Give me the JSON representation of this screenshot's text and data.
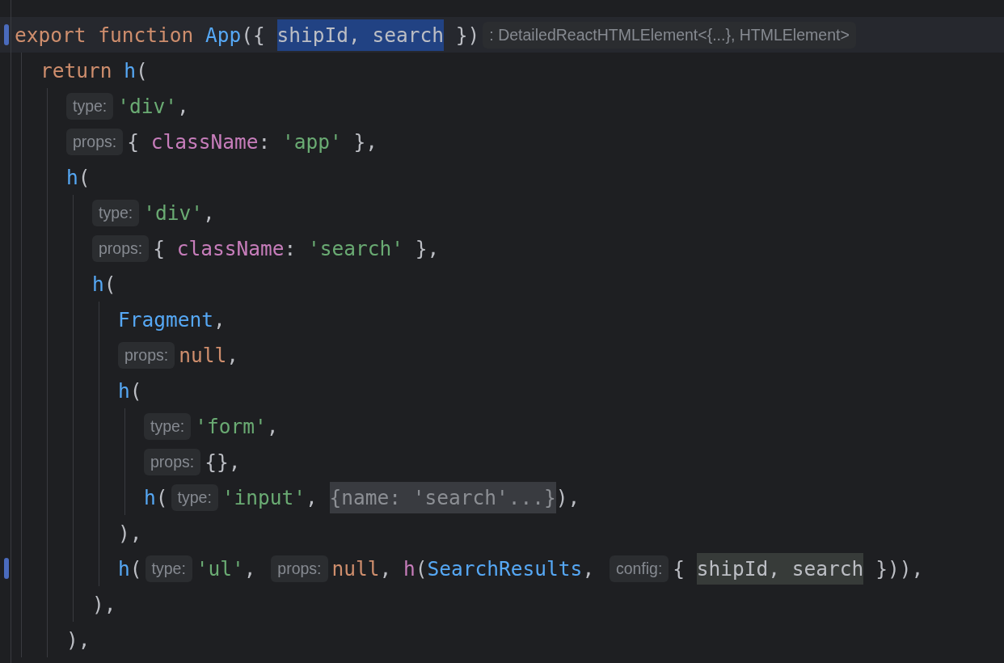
{
  "lines": [
    {
      "modified": true,
      "current": true,
      "tokens": [
        {
          "kind": "keyword",
          "t": "export"
        },
        {
          "kind": "keyword",
          "t": " function"
        },
        {
          "kind": "fn",
          "t": " App"
        },
        {
          "kind": "plain",
          "t": "({ "
        },
        {
          "kind": "selection",
          "t": "shipId, search"
        },
        {
          "kind": "plain",
          "t": " })"
        },
        {
          "kind": "hint",
          "t": ": DetailedReactHTMLElement<{...}, HTMLElement>"
        }
      ],
      "children": [
        {
          "modified": false,
          "current": false,
          "tokens": [
            {
              "kind": "keyword",
              "t": "return"
            },
            {
              "kind": "fn",
              "t": " h"
            },
            {
              "kind": "plain",
              "t": "("
            }
          ],
          "children": [
            {
              "modified": false,
              "current": false,
              "tokens": [
                {
                  "kind": "hint",
                  "t": "type:"
                },
                {
                  "kind": "string",
                  "t": "'div'"
                },
                {
                  "kind": "plain",
                  "t": ","
                }
              ]
            },
            {
              "modified": false,
              "current": false,
              "tokens": [
                {
                  "kind": "hint",
                  "t": "props:"
                },
                {
                  "kind": "plain",
                  "t": "{ "
                },
                {
                  "kind": "prop",
                  "t": "className"
                },
                {
                  "kind": "plain",
                  "t": ": "
                },
                {
                  "kind": "string",
                  "t": "'app'"
                },
                {
                  "kind": "plain",
                  "t": " },"
                }
              ]
            },
            {
              "modified": false,
              "current": false,
              "tokens": [
                {
                  "kind": "fn",
                  "t": "h"
                },
                {
                  "kind": "plain",
                  "t": "("
                }
              ],
              "children": [
                {
                  "modified": false,
                  "current": false,
                  "tokens": [
                    {
                      "kind": "hint",
                      "t": "type:"
                    },
                    {
                      "kind": "string",
                      "t": "'div'"
                    },
                    {
                      "kind": "plain",
                      "t": ","
                    }
                  ]
                },
                {
                  "modified": false,
                  "current": false,
                  "tokens": [
                    {
                      "kind": "hint",
                      "t": "props:"
                    },
                    {
                      "kind": "plain",
                      "t": "{ "
                    },
                    {
                      "kind": "prop",
                      "t": "className"
                    },
                    {
                      "kind": "plain",
                      "t": ": "
                    },
                    {
                      "kind": "string",
                      "t": "'search'"
                    },
                    {
                      "kind": "plain",
                      "t": " },"
                    }
                  ]
                },
                {
                  "modified": false,
                  "current": false,
                  "tokens": [
                    {
                      "kind": "fn",
                      "t": "h"
                    },
                    {
                      "kind": "plain",
                      "t": "("
                    }
                  ],
                  "children": [
                    {
                      "modified": false,
                      "current": false,
                      "tokens": [
                        {
                          "kind": "fn",
                          "t": "Fragment"
                        },
                        {
                          "kind": "plain",
                          "t": ","
                        }
                      ]
                    },
                    {
                      "modified": false,
                      "current": false,
                      "tokens": [
                        {
                          "kind": "hint",
                          "t": "props:"
                        },
                        {
                          "kind": "keyword",
                          "t": "null"
                        },
                        {
                          "kind": "plain",
                          "t": ","
                        }
                      ]
                    },
                    {
                      "modified": false,
                      "current": false,
                      "tokens": [
                        {
                          "kind": "fn",
                          "t": "h"
                        },
                        {
                          "kind": "plain",
                          "t": "("
                        }
                      ],
                      "children": [
                        {
                          "modified": false,
                          "current": false,
                          "tokens": [
                            {
                              "kind": "hint",
                              "t": "type:"
                            },
                            {
                              "kind": "string",
                              "t": "'form'"
                            },
                            {
                              "kind": "plain",
                              "t": ","
                            }
                          ]
                        },
                        {
                          "modified": false,
                          "current": false,
                          "tokens": [
                            {
                              "kind": "hint",
                              "t": "props:"
                            },
                            {
                              "kind": "plain",
                              "t": "{},"
                            }
                          ]
                        },
                        {
                          "modified": false,
                          "current": false,
                          "tokens": [
                            {
                              "kind": "fn",
                              "t": "h"
                            },
                            {
                              "kind": "plain",
                              "t": "("
                            },
                            {
                              "kind": "hint",
                              "t": "type:"
                            },
                            {
                              "kind": "string",
                              "t": "'input'"
                            },
                            {
                              "kind": "plain",
                              "t": ", "
                            },
                            {
                              "kind": "fold",
                              "t": "{name: 'search'...}"
                            },
                            {
                              "kind": "plain",
                              "t": "),"
                            }
                          ]
                        }
                      ]
                    },
                    {
                      "modified": false,
                      "current": false,
                      "tokens": [
                        {
                          "kind": "plain",
                          "t": "),"
                        }
                      ]
                    },
                    {
                      "modified": true,
                      "current": false,
                      "tokens": [
                        {
                          "kind": "fn",
                          "t": "h"
                        },
                        {
                          "kind": "plain",
                          "t": "("
                        },
                        {
                          "kind": "hint",
                          "t": "type:"
                        },
                        {
                          "kind": "string",
                          "t": "'ul'"
                        },
                        {
                          "kind": "plain",
                          "t": ", "
                        },
                        {
                          "kind": "hint",
                          "t": "props:"
                        },
                        {
                          "kind": "keyword",
                          "t": "null"
                        },
                        {
                          "kind": "plain",
                          "t": ", "
                        },
                        {
                          "kind": "prop",
                          "t": "h"
                        },
                        {
                          "kind": "plain",
                          "t": "("
                        },
                        {
                          "kind": "fn",
                          "t": "SearchResults"
                        },
                        {
                          "kind": "plain",
                          "t": ", "
                        },
                        {
                          "kind": "hint",
                          "t": "config:"
                        },
                        {
                          "kind": "plain",
                          "t": "{ "
                        },
                        {
                          "kind": "usage",
                          "t": "shipId, search"
                        },
                        {
                          "kind": "plain",
                          "t": " })),"
                        }
                      ]
                    }
                  ]
                },
                {
                  "modified": false,
                  "current": false,
                  "tokens": [
                    {
                      "kind": "plain",
                      "t": "),"
                    }
                  ]
                }
              ]
            },
            {
              "modified": false,
              "current": false,
              "tokens": [
                {
                  "kind": "plain",
                  "t": "),"
                }
              ]
            }
          ]
        }
      ]
    }
  ]
}
